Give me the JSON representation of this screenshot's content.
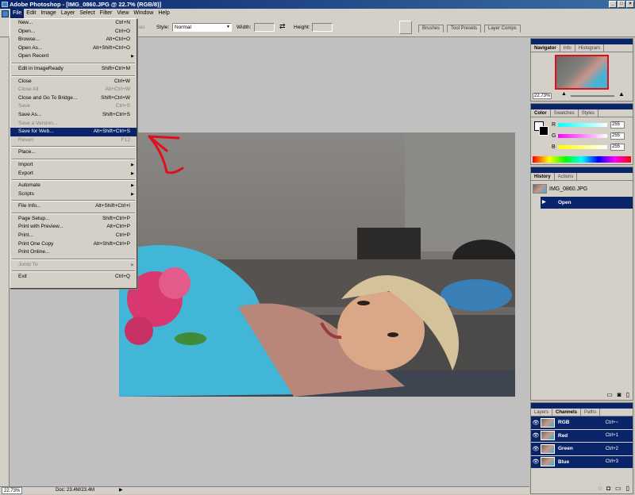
{
  "window": {
    "title": "Adobe Photoshop - [IMG_0860.JPG @ 22.7% (RGB/8)]"
  },
  "menubar": [
    "File",
    "Edit",
    "Image",
    "Layer",
    "Select",
    "Filter",
    "View",
    "Window",
    "Help"
  ],
  "options": {
    "style_label": "Style:",
    "style_value": "Normal",
    "width_label": "Width:",
    "height_label": "Height:",
    "partial_label": "lias"
  },
  "well_tabs": [
    "Brushes",
    "Tool Presets",
    "Layer Comps"
  ],
  "file_menu": [
    {
      "label": "New...",
      "shortcut": "Ctrl+N",
      "state": "normal"
    },
    {
      "label": "Open...",
      "shortcut": "Ctrl+O",
      "state": "normal"
    },
    {
      "label": "Browse...",
      "shortcut": "Alt+Ctrl+O",
      "state": "normal"
    },
    {
      "label": "Open As...",
      "shortcut": "Alt+Shift+Ctrl+O",
      "state": "normal"
    },
    {
      "label": "Open Recent",
      "shortcut": "",
      "state": "submenu"
    },
    {
      "sep": true
    },
    {
      "label": "Edit in ImageReady",
      "shortcut": "Shift+Ctrl+M",
      "state": "normal"
    },
    {
      "sep": true
    },
    {
      "label": "Close",
      "shortcut": "Ctrl+W",
      "state": "normal"
    },
    {
      "label": "Close All",
      "shortcut": "Alt+Ctrl+W",
      "state": "disabled"
    },
    {
      "label": "Close and Go To Bridge...",
      "shortcut": "Shift+Ctrl+W",
      "state": "normal"
    },
    {
      "label": "Save",
      "shortcut": "Ctrl+S",
      "state": "disabled"
    },
    {
      "label": "Save As...",
      "shortcut": "Shift+Ctrl+S",
      "state": "normal"
    },
    {
      "label": "Save a Version...",
      "shortcut": "",
      "state": "disabled"
    },
    {
      "label": "Save for Web...",
      "shortcut": "Alt+Shift+Ctrl+S",
      "state": "selected"
    },
    {
      "label": "Revert",
      "shortcut": "F12",
      "state": "disabled"
    },
    {
      "sep": true
    },
    {
      "label": "Place...",
      "shortcut": "",
      "state": "normal"
    },
    {
      "sep": true
    },
    {
      "label": "Import",
      "shortcut": "",
      "state": "submenu"
    },
    {
      "label": "Export",
      "shortcut": "",
      "state": "submenu"
    },
    {
      "sep": true
    },
    {
      "label": "Automate",
      "shortcut": "",
      "state": "submenu"
    },
    {
      "label": "Scripts",
      "shortcut": "",
      "state": "submenu"
    },
    {
      "sep": true
    },
    {
      "label": "File Info...",
      "shortcut": "Alt+Shift+Ctrl+I",
      "state": "normal"
    },
    {
      "sep": true
    },
    {
      "label": "Page Setup...",
      "shortcut": "Shift+Ctrl+P",
      "state": "normal"
    },
    {
      "label": "Print with Preview...",
      "shortcut": "Alt+Ctrl+P",
      "state": "normal"
    },
    {
      "label": "Print...",
      "shortcut": "Ctrl+P",
      "state": "normal"
    },
    {
      "label": "Print One Copy",
      "shortcut": "Alt+Shift+Ctrl+P",
      "state": "normal"
    },
    {
      "label": "Print Online...",
      "shortcut": "",
      "state": "normal"
    },
    {
      "sep": true
    },
    {
      "label": "Jump To",
      "shortcut": "",
      "state": "disabled-submenu"
    },
    {
      "sep": true
    },
    {
      "label": "Exit",
      "shortcut": "Ctrl+Q",
      "state": "normal"
    }
  ],
  "navigator": {
    "tabs": [
      "Navigator",
      "Info",
      "Histogram"
    ],
    "zoom": "22.73%"
  },
  "color": {
    "tabs": [
      "Color",
      "Swatches",
      "Styles"
    ],
    "channels": [
      {
        "label": "R",
        "value": "255"
      },
      {
        "label": "G",
        "value": "255"
      },
      {
        "label": "B",
        "value": "255"
      }
    ]
  },
  "history": {
    "tabs": [
      "History",
      "Actions"
    ],
    "snapshot": "IMG_0860.JPG",
    "step": "Open"
  },
  "channels_panel": {
    "tabs": [
      "Layers",
      "Channels",
      "Paths"
    ],
    "rows": [
      {
        "name": "RGB",
        "shortcut": "Ctrl+~"
      },
      {
        "name": "Red",
        "shortcut": "Ctrl+1"
      },
      {
        "name": "Green",
        "shortcut": "Ctrl+2"
      },
      {
        "name": "Blue",
        "shortcut": "Ctrl+3"
      }
    ]
  },
  "status": {
    "zoom": "22.73%",
    "doc": "Doc: 23.4M/23.4M"
  },
  "colors": {
    "accent": "#0a246a",
    "ui": "#d4d0c8",
    "canvas": "#c0c0c0",
    "annotation": "#e0101a"
  }
}
